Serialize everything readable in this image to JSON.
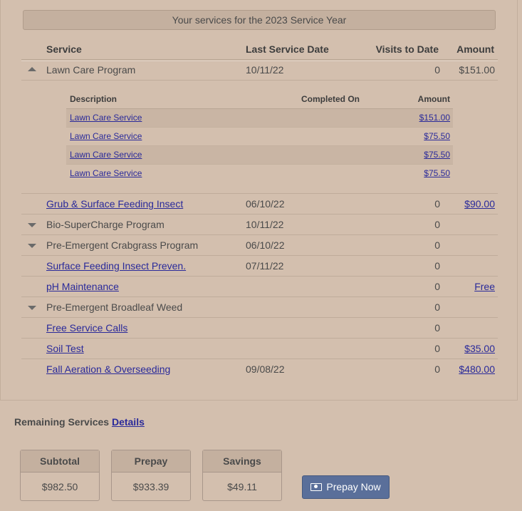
{
  "banner": "Your services for the 2023 Service Year",
  "columns": {
    "service": "Service",
    "last_date": "Last Service Date",
    "visits": "Visits to Date",
    "amount": "Amount"
  },
  "services": [
    {
      "name": "Lawn Care Program",
      "date": "10/11/22",
      "visits": "0",
      "amount": "$151.00",
      "link": false,
      "caret": "up"
    },
    {
      "name": "Grub & Surface Feeding Insect",
      "date": "06/10/22",
      "visits": "0",
      "amount": "$90.00",
      "link": true,
      "caret": ""
    },
    {
      "name": "Bio-SuperCharge Program",
      "date": "10/11/22",
      "visits": "0",
      "amount": "",
      "link": false,
      "caret": "down"
    },
    {
      "name": "Pre-Emergent Crabgrass Program",
      "date": "06/10/22",
      "visits": "0",
      "amount": "",
      "link": false,
      "caret": "down"
    },
    {
      "name": "Surface Feeding Insect Preven.",
      "date": "07/11/22",
      "visits": "0",
      "amount": "",
      "link": true,
      "caret": ""
    },
    {
      "name": "pH Maintenance",
      "date": "",
      "visits": "0",
      "amount": "Free",
      "link": true,
      "caret": ""
    },
    {
      "name": "Pre-Emergent Broadleaf Weed",
      "date": "",
      "visits": "0",
      "amount": "",
      "link": false,
      "caret": "down"
    },
    {
      "name": "Free Service Calls",
      "date": "",
      "visits": "0",
      "amount": "",
      "link": true,
      "caret": ""
    },
    {
      "name": "Soil Test",
      "date": "",
      "visits": "0",
      "amount": "$35.00",
      "link": true,
      "caret": ""
    },
    {
      "name": "Fall Aeration & Overseeding",
      "date": "09/08/22",
      "visits": "0",
      "amount": "$480.00",
      "link": true,
      "caret": ""
    }
  ],
  "sub_table": {
    "columns": {
      "description": "Description",
      "completed": "Completed On",
      "amount": "Amount"
    },
    "rows": [
      {
        "description": "Lawn Care Service",
        "completed": "",
        "amount": "$151.00"
      },
      {
        "description": "Lawn Care Service",
        "completed": "",
        "amount": "$75.50"
      },
      {
        "description": "Lawn Care Service",
        "completed": "",
        "amount": "$75.50"
      },
      {
        "description": "Lawn Care Service",
        "completed": "",
        "amount": "$75.50"
      }
    ]
  },
  "remaining": {
    "label": "Remaining Services",
    "link": "Details"
  },
  "totals": {
    "subtotal_label": "Subtotal",
    "subtotal": "$982.50",
    "prepay_label": "Prepay",
    "prepay": "$933.39",
    "savings_label": "Savings",
    "savings": "$49.11"
  },
  "prepay_button": "Prepay Now",
  "icons": {
    "expanded": "caret-up-icon",
    "collapsed": "caret-down-icon",
    "button": "cash-icon"
  }
}
